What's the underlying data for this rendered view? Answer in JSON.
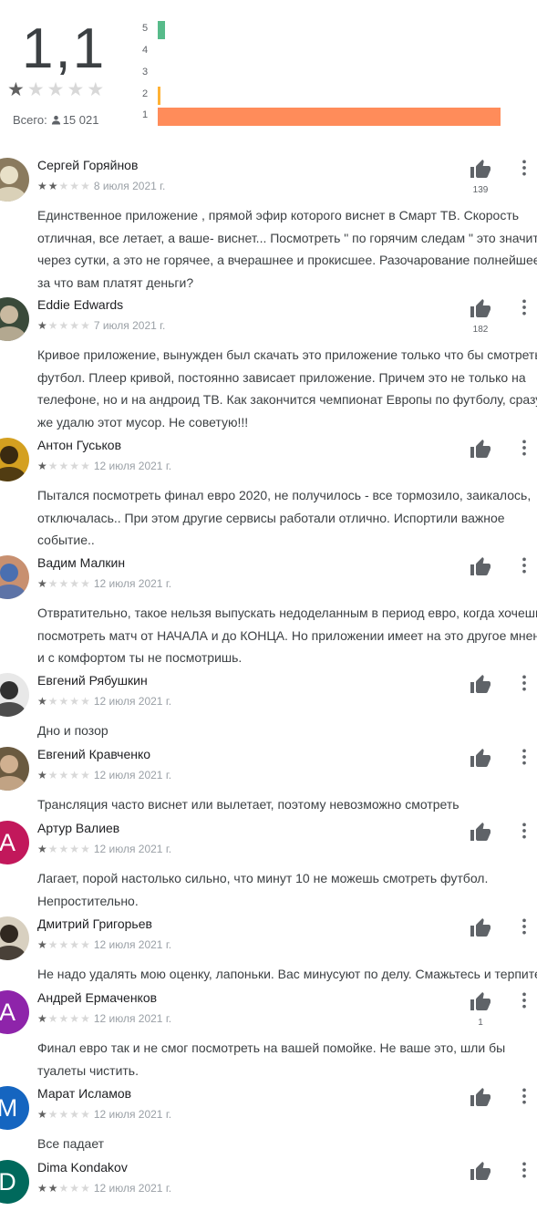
{
  "summary": {
    "average": "1,1",
    "stars": 1,
    "total_label": "Всего:",
    "total_count": "15 021",
    "histogram": [
      {
        "star": "5",
        "fraction": 0.02,
        "color": "#57bb8a"
      },
      {
        "star": "4",
        "fraction": 0.0,
        "color": "#9ace6a"
      },
      {
        "star": "3",
        "fraction": 0.0,
        "color": "#ffcf02"
      },
      {
        "star": "2",
        "fraction": 0.007,
        "color": "#ffb235"
      },
      {
        "star": "1",
        "fraction": 1.0,
        "color": "#ff8c5a"
      }
    ]
  },
  "reviews": [
    {
      "name": "Сергей Горяйнов",
      "stars": 2,
      "date": "8 июля 2021 г.",
      "likes": "139",
      "text": "Единственное приложение , прямой эфир которого виснет в Смарт ТВ. Скорость\nотличная, все летает, а ваше- виснет... Посмотреть \" по горячим следам \" это значит\nчерез сутки, а это не горячее, а вчерашнее и прокисшее. Разочарование полнейшее,\nза что вам платят деньги?",
      "avatar": {
        "type": "photo",
        "bg": "#8a7a5e",
        "fg": "#e8e0c8"
      }
    },
    {
      "name": "Eddie Edwards",
      "stars": 1,
      "date": "7 июля 2021 г.",
      "likes": "182",
      "text": "Кривое приложение, вынужден был скачать это приложение только что бы смотреть\nфутбол. Плеер кривой, постоянно зависает приложение. Причем это не только на\nтелефоне, но и на андроид ТВ. Как закончится чемпионат Европы по футболу, сразу\nже удалю этот мусор. Не советую!!!",
      "avatar": {
        "type": "photo",
        "bg": "#3a4a3a",
        "fg": "#c9b9a0"
      }
    },
    {
      "name": "Антон Гуськов",
      "stars": 1,
      "date": "12 июля 2021 г.",
      "likes": "",
      "text": "Пытался посмотреть финал евро 2020, не получилось - все тормозило, заикалось,\nотключалась.. При этом другие сервисы работали отлично. Испортили важное\nсобытие..",
      "avatar": {
        "type": "photo",
        "bg": "#d4a020",
        "fg": "#3a2a10"
      }
    },
    {
      "name": "Вадим Малкин",
      "stars": 1,
      "date": "12 июля 2021 г.",
      "likes": "",
      "text": "Отвратительно, такое нельзя выпускать недоделанным в период евро, когда хочешь\nпосмотреть матч от НАЧАЛА и до КОНЦА. Но приложении имеет на это другое мнение\nи с комфортом ты не посмотришь.",
      "avatar": {
        "type": "photo",
        "bg": "#c89070",
        "fg": "#4a6fb0"
      }
    },
    {
      "name": "Евгений Рябушкин",
      "stars": 1,
      "date": "12 июля 2021 г.",
      "likes": "",
      "text": "Дно и позор",
      "avatar": {
        "type": "photo",
        "bg": "#e8e8e8",
        "fg": "#303030"
      }
    },
    {
      "name": "Евгений Кравченко",
      "stars": 1,
      "date": "12 июля 2021 г.",
      "likes": "",
      "text": "Трансляция часто виснет или вылетает, поэтому невозможно смотреть",
      "avatar": {
        "type": "photo",
        "bg": "#6a5a40",
        "fg": "#d0b090"
      }
    },
    {
      "name": "Артур Валиев",
      "stars": 1,
      "date": "12 июля 2021 г.",
      "likes": "",
      "text": "Лагает, порой настолько сильно, что минут 10 не можешь смотреть футбол.\nНепростительно.",
      "avatar": {
        "type": "letter",
        "letter": "A",
        "bg": "#c2185b"
      }
    },
    {
      "name": "Дмитрий Григорьев",
      "stars": 1,
      "date": "12 июля 2021 г.",
      "likes": "",
      "text": "Не надо удалять мою оценку, лапоньки. Вас минусуют по делу. Смажьтесь и терпите",
      "avatar": {
        "type": "photo",
        "bg": "#d8d0c0",
        "fg": "#302820"
      }
    },
    {
      "name": "Андрей Ермаченков",
      "stars": 1,
      "date": "12 июля 2021 г.",
      "likes": "1",
      "text": "Финал евро так и не смог посмотреть на вашей помойке. Не ваше это, шли бы\nтуалеты чистить.",
      "avatar": {
        "type": "letter",
        "letter": "A",
        "bg": "#8e24aa"
      }
    },
    {
      "name": "Марат Исламов",
      "stars": 1,
      "date": "12 июля 2021 г.",
      "likes": "",
      "text": "Все падает",
      "avatar": {
        "type": "letter",
        "letter": "M",
        "bg": "#1565c0"
      }
    },
    {
      "name": "Dima Kondakov",
      "stars": 2,
      "date": "12 июля 2021 г.",
      "likes": "",
      "text": "",
      "avatar": {
        "type": "letter",
        "letter": "D",
        "bg": "#00695c"
      }
    }
  ]
}
